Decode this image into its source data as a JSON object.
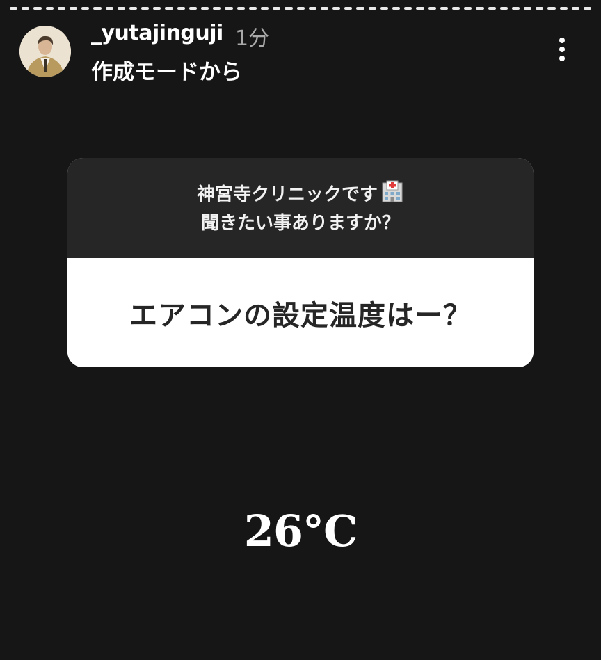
{
  "header": {
    "username": "_yutajinguji",
    "time": "1分",
    "subtitle": "作成モードから"
  },
  "question_sticker": {
    "prompt_line1": "神宮寺クリニックです",
    "prompt_line2": "聞きたい事ありますか？",
    "question": "エアコンの設定温度はー？"
  },
  "answer_text": "26°C",
  "icons": {
    "more": "more-vertical-icon",
    "hospital": "hospital-icon",
    "avatar": "avatar"
  },
  "colors": {
    "background": "#161616",
    "card_top": "#262626",
    "card_bottom": "#ffffff",
    "time_gray": "#a9a9a9"
  }
}
